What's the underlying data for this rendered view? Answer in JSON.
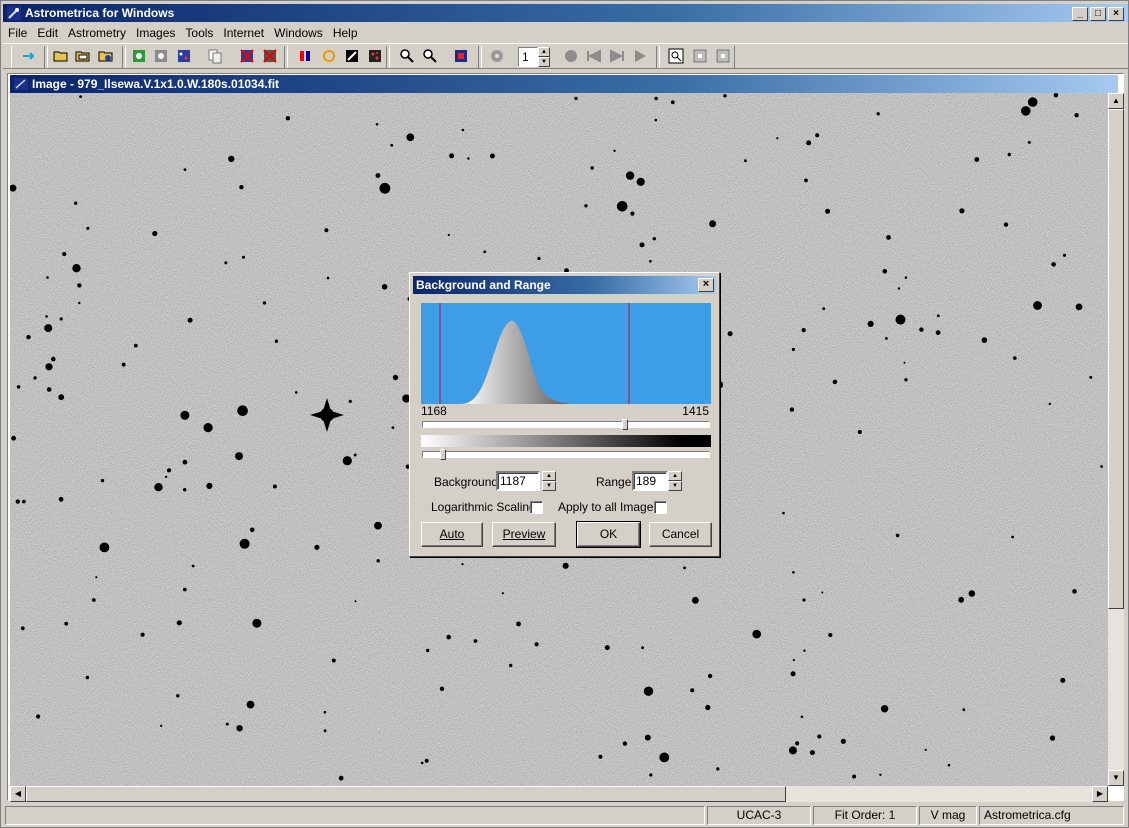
{
  "app": {
    "title": "Astrometrica for Windows",
    "icon": "comet-icon"
  },
  "window_buttons": [
    "minimize",
    "maximize",
    "close"
  ],
  "menu": [
    "File",
    "Edit",
    "Astrometry",
    "Images",
    "Tools",
    "Internet",
    "Windows",
    "Help"
  ],
  "toolbar": {
    "frame_value": "1",
    "icons": [
      "arrow-right-icon",
      "open-folder-icon",
      "open-folder-stack-icon",
      "load-images-icon",
      "settings-green-icon",
      "settings-gray-icon",
      "blink-stars-icon",
      "copy-icon",
      "delete-stars-icon",
      "delete-images-icon",
      "color-icon",
      "circle-icon",
      "compass-icon",
      "red-grid-icon",
      "zoom-in-icon",
      "zoom-out-icon",
      "flag-icon",
      "film-icon",
      "record-icon",
      "previous-icon",
      "next-icon",
      "play-icon",
      "zoom-fit-icon",
      "small-square-icon",
      "small-square-2-icon"
    ]
  },
  "image_window": {
    "title": "Image - 979_Ilsewa.V.1x1.0.W.180s.01034.fit"
  },
  "dialog": {
    "title": "Background and Range",
    "hist_min": "1168",
    "hist_max": "1415",
    "background_label": "Background",
    "background_value": "1187",
    "range_label": "Range",
    "range_value": "189",
    "log_label": "Logarithmic Scaling",
    "log_checked": false,
    "apply_label": "Apply to all Images",
    "apply_checked": false,
    "buttons": {
      "auto": "Auto",
      "preview": "Preview",
      "ok": "OK",
      "cancel": "Cancel"
    },
    "upper_slider_value": 0.71,
    "lower_slider_value": 0.06,
    "colors": {
      "histogram_bg": "#3d9ee7",
      "marker": "#c0103a"
    }
  },
  "statusbar": {
    "catalog": "UCAC-3",
    "fit_order": "Fit Order: 1",
    "mag": "V mag",
    "config": "Astrometrica.cfg"
  }
}
